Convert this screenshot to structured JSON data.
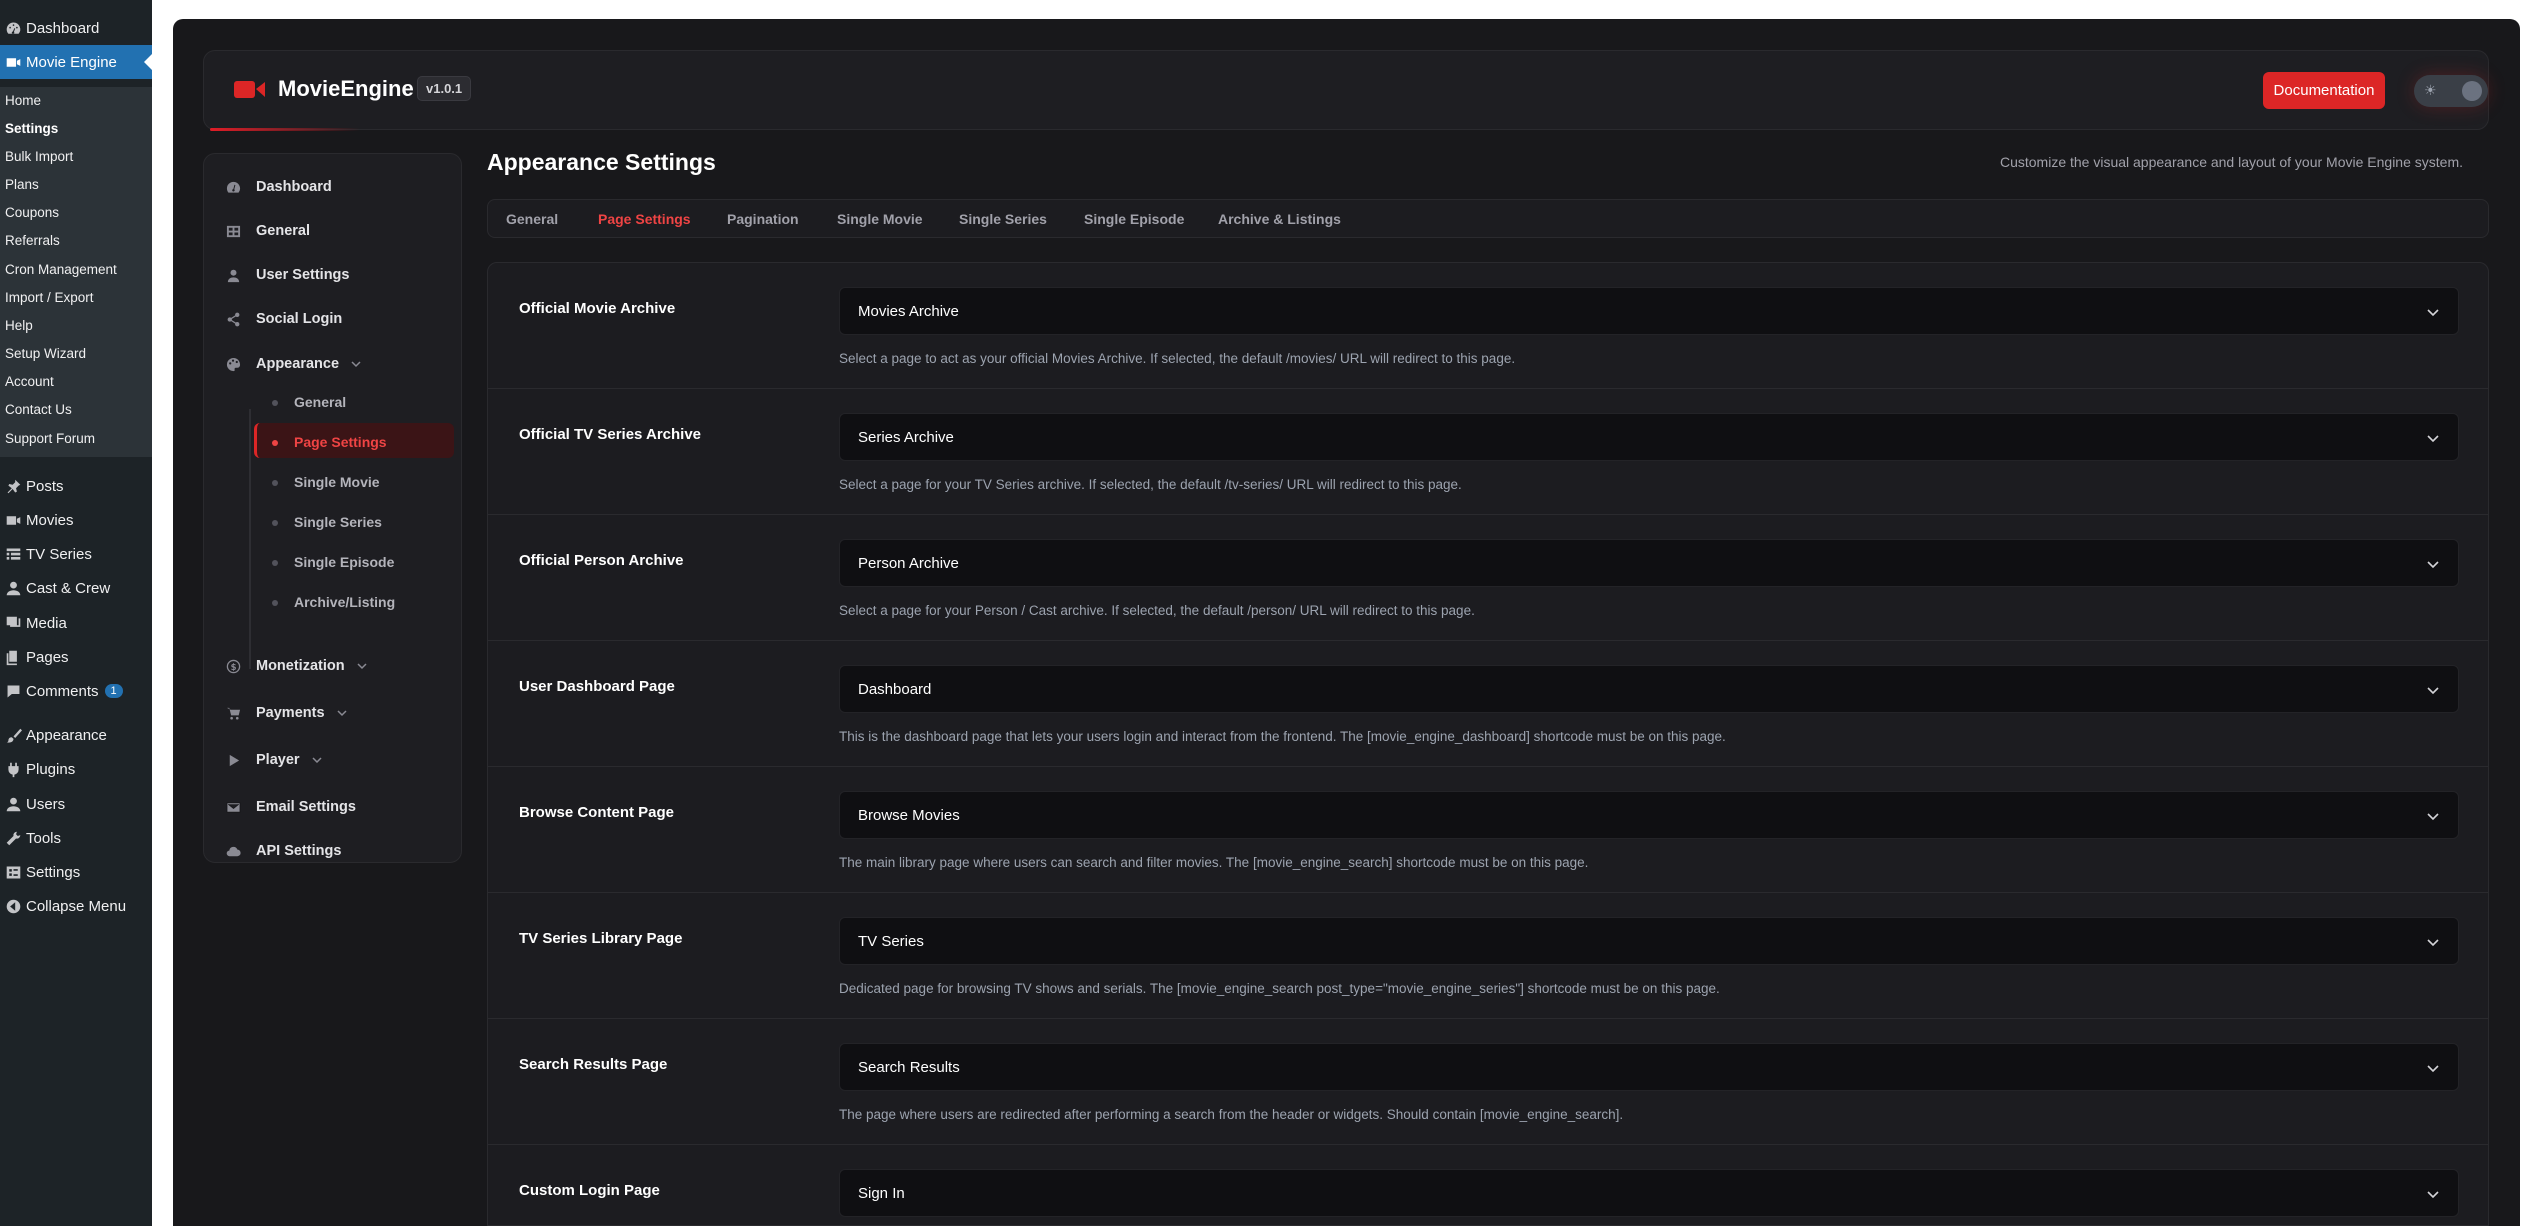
{
  "wp_menu": {
    "items": [
      {
        "label": "Dashboard",
        "icon": "dashboard-icon"
      },
      {
        "label": "Movie Engine",
        "icon": "video-icon"
      },
      {
        "label": "Posts",
        "icon": "pin-icon"
      },
      {
        "label": "Movies",
        "icon": "video-icon"
      },
      {
        "label": "TV Series",
        "icon": "list-icon"
      },
      {
        "label": "Cast & Crew",
        "icon": "user-icon"
      },
      {
        "label": "Media",
        "icon": "media-icon"
      },
      {
        "label": "Pages",
        "icon": "pages-icon"
      },
      {
        "label": "Comments",
        "icon": "comment-icon",
        "badge": "1"
      },
      {
        "label": "Appearance",
        "icon": "brush-icon"
      },
      {
        "label": "Plugins",
        "icon": "plug-icon"
      },
      {
        "label": "Users",
        "icon": "user-icon"
      },
      {
        "label": "Tools",
        "icon": "wrench-icon"
      },
      {
        "label": "Settings",
        "icon": "settings-icon"
      },
      {
        "label": "Collapse Menu",
        "icon": "collapse-icon"
      }
    ],
    "submenu": [
      "Home",
      "Settings",
      "Bulk Import",
      "Plans",
      "Coupons",
      "Referrals",
      "Cron Management",
      "Import / Export",
      "Help",
      "Setup Wizard",
      "Account",
      "Contact Us",
      "Support Forum"
    ]
  },
  "header": {
    "brand": "MovieEngine",
    "version": "v1.0.1",
    "doc_button": "Documentation"
  },
  "sidebar": {
    "items": [
      {
        "label": "Dashboard",
        "icon": "dashboard-icon"
      },
      {
        "label": "General",
        "icon": "grid-icon"
      },
      {
        "label": "User Settings",
        "icon": "user-icon"
      },
      {
        "label": "Social Login",
        "icon": "share-icon"
      },
      {
        "label": "Appearance",
        "icon": "palette-icon"
      },
      {
        "label": "Monetization",
        "icon": "dollar-icon"
      },
      {
        "label": "Payments",
        "icon": "cart-icon"
      },
      {
        "label": "Player",
        "icon": "play-icon"
      },
      {
        "label": "Email Settings",
        "icon": "mail-icon"
      },
      {
        "label": "API Settings",
        "icon": "cloud-icon"
      }
    ],
    "appearance_sub": [
      "General",
      "Page Settings",
      "Single Movie",
      "Single Series",
      "Single Episode",
      "Archive/Listing"
    ]
  },
  "page": {
    "title": "Appearance Settings",
    "subtitle": "Customize the visual appearance and layout of your Movie Engine system.",
    "tabs": [
      "General",
      "Page Settings",
      "Pagination",
      "Single Movie",
      "Single Series",
      "Single Episode",
      "Archive & Listings"
    ],
    "active_tab": "Page Settings"
  },
  "settings": [
    {
      "label": "Official Movie Archive",
      "value": "Movies Archive",
      "desc": "Select a page to act as your official Movies Archive. If selected, the default /movies/ URL will redirect to this page."
    },
    {
      "label": "Official TV Series Archive",
      "value": "Series Archive",
      "desc": "Select a page for your TV Series archive. If selected, the default /tv-series/ URL will redirect to this page."
    },
    {
      "label": "Official Person Archive",
      "value": "Person Archive",
      "desc": "Select a page for your Person / Cast archive. If selected, the default /person/ URL will redirect to this page."
    },
    {
      "label": "User Dashboard Page",
      "value": "Dashboard",
      "desc": "This is the dashboard page that lets your users login and interact from the frontend. The [movie_engine_dashboard] shortcode must be on this page."
    },
    {
      "label": "Browse Content Page",
      "value": "Browse Movies",
      "desc": "The main library page where users can search and filter movies. The [movie_engine_search] shortcode must be on this page."
    },
    {
      "label": "TV Series Library Page",
      "value": "TV Series",
      "desc": "Dedicated page for browsing TV shows and serials. The [movie_engine_search post_type=\"movie_engine_series\"] shortcode must be on this page."
    },
    {
      "label": "Search Results Page",
      "value": "Search Results",
      "desc": "The page where users are redirected after performing a search from the header or widgets. Should contain [movie_engine_search]."
    },
    {
      "label": "Custom Login Page",
      "value": "Sign In",
      "desc": ""
    }
  ],
  "colors": {
    "accent": "#dc2626",
    "wp_active": "#2271b1"
  }
}
